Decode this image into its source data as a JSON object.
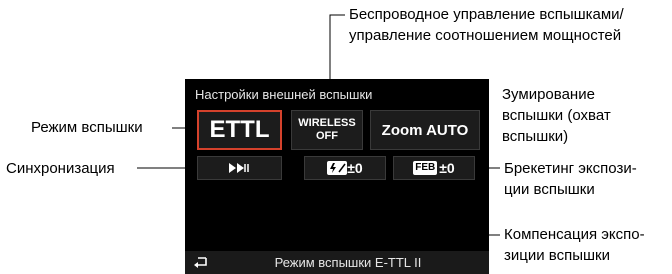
{
  "callouts": {
    "top_line1": "Беспроводное управление вспышками/",
    "top_line2": "управление соотношением мощностей",
    "zoom_line1": "Зумирование",
    "zoom_line2": "вспышки (охват",
    "zoom_line3": "вспышки)",
    "mode": "Режим вспышки",
    "sync": "Синхронизация",
    "feb_line1": "Брекетинг экспози-",
    "feb_line2": "ции вспышки",
    "comp_line1": "Компенсация экспо-",
    "comp_line2": "зиции вспышки"
  },
  "screen": {
    "title": "Настройки внешней вспышки",
    "mode_value": "ETTL",
    "wireless_line1": "WIRELESS",
    "wireless_line2": "OFF",
    "zoom_value": "Zoom AUTO",
    "comp_icon": "flash-exposure-comp-icon",
    "comp_value": "±0",
    "feb_icon_label": "FEB",
    "feb_value": "±0",
    "bottom_label": "Режим вспышки E-TTL II",
    "back_icon": "return-arrow-icon",
    "sync_icon": "high-speed-sync-icon"
  },
  "colors": {
    "selection": "#d5422c",
    "screen_bg": "#000000"
  }
}
